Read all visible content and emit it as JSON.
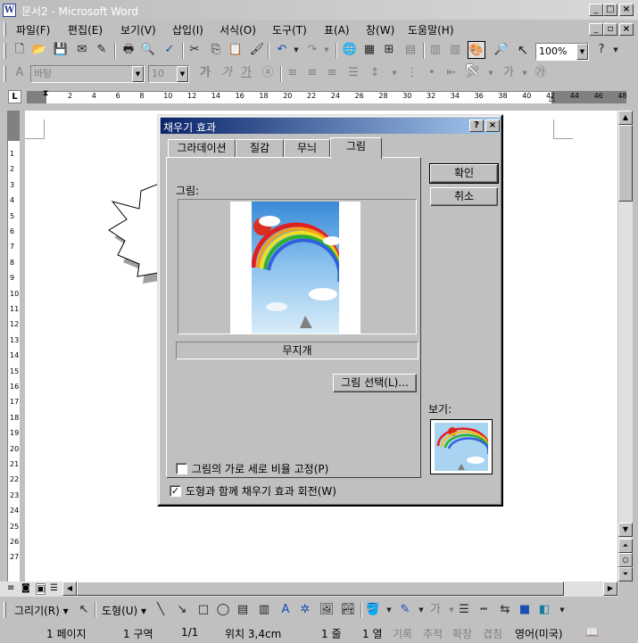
{
  "window": {
    "title": "문서2 - Microsoft Word",
    "app_icon": "word-app-icon",
    "controls": [
      "minimize-icon",
      "maximize-icon",
      "close-icon"
    ]
  },
  "menubar": {
    "items": [
      "파일(F)",
      "편집(E)",
      "보기(V)",
      "삽입(I)",
      "서식(O)",
      "도구(T)",
      "표(A)",
      "창(W)",
      "도움말(H)"
    ]
  },
  "standard_toolbar": {
    "zoom": "100%"
  },
  "format_toolbar": {
    "font": "바탕",
    "size": "10"
  },
  "ruler": {
    "numbers": [
      "2",
      "4",
      "6",
      "8",
      "10",
      "12",
      "14",
      "16",
      "18",
      "20",
      "22",
      "24",
      "26",
      "28",
      "30",
      "32",
      "34",
      "36",
      "38",
      "40",
      "42",
      "44",
      "46",
      "48"
    ],
    "vnumbers": [
      "1",
      "2",
      "3",
      "4",
      "5",
      "6",
      "7",
      "8",
      "9",
      "10",
      "11",
      "12",
      "13",
      "14",
      "15",
      "16",
      "17",
      "18",
      "19",
      "20",
      "21",
      "22",
      "23",
      "24",
      "25",
      "26",
      "27"
    ]
  },
  "dialog": {
    "title": "채우기 효과",
    "help_btn": "?",
    "close_btn": "×",
    "tabs": [
      "그라데이션",
      "질감",
      "무늬",
      "그림"
    ],
    "active_tab": "그림",
    "picture_label": "그림:",
    "picture_name": "무지개",
    "select_picture": "그림 선택(L)...",
    "lock_ratio": "그림의 가로 세로 비율 고정(P)",
    "lock_ratio_checked": false,
    "rotate_with_shape": "도형과 함께 채우기 효과 회전(W)",
    "rotate_checked": true,
    "ok": "확인",
    "cancel": "취소",
    "preview_label": "보기:"
  },
  "drawing_toolbar": {
    "draw_menu": "그리기(R)",
    "autoshape_menu": "도형(U)"
  },
  "statusbar": {
    "page": "1 페이지",
    "section": "1 구역",
    "page_of": "1/1",
    "position": "위치 3,4cm",
    "line": "1 줄",
    "column": "1 열",
    "rec": "기록",
    "trk": "추적",
    "ext": "확장",
    "ovr": "겹침",
    "language": "영어(미국)"
  }
}
